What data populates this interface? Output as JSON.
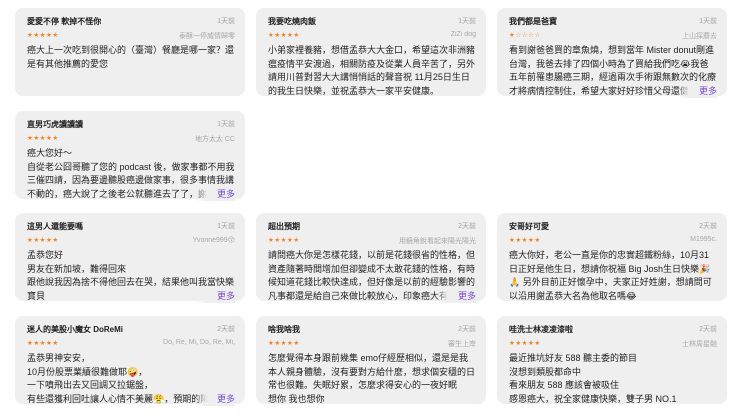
{
  "accent_color": "#7b4ae2",
  "star_color": "#f5821f",
  "reviews": [
    {
      "title": "愛愛不停 軟掉不怪你",
      "date": "1天前",
      "author": "泰酥一停威情歸零",
      "rating": 5,
      "body": "癌大上一次吃到很開心的（臺灣）餐廳是哪一家？還是有其他推薦的愛您",
      "more": ""
    },
    {
      "title": "我要吃燒肉飯",
      "date": "1天前",
      "author": "ZiZi dog",
      "rating": 5,
      "body": "小弟家裡養豬，想借孟恭大大金口，希望這次非洲豬瘟疫情平安渡過，相關防疫及從業人員辛苦了，另外請用川普對習大大講悄悄話的聲音祝 11月25日生日的我生日快樂，並祝孟恭大一家平安健康。",
      "more": ""
    },
    {
      "title": "我們都是爸寶",
      "date": "1天前",
      "author": "上山採蘑去",
      "rating": 1,
      "body": "看到謝爸爸買的章魚燒，想到當年 Mister donut剛進台灣，我爸去排了四個小時為了買給我們吃😭我爸五年前罹患腸癌三期，經過兩次手術跟無數次的化療才將病情控制住，希望大家好好珍惜父母還健康的時候",
      "more": "更多"
    },
    {
      "title": "直男巧虎讀讀讀",
      "date": "1天前",
      "author": "地方太太 CC",
      "rating": 5,
      "body": "癌大您好～\n自從老公囧哥聽了您的 podcast 後，做家事都不用我三催四請，因為要邊聽股癌邊做家事，很多事情我講不動的，癌大說了之後老公就聽進去了了，謝謝癌大",
      "more": "更多"
    },
    {
      "title": "這男人還能要嗎",
      "date": "1天前",
      "author": "Yvonne999😚",
      "rating": 5,
      "body": "孟恭您好\n男友在新加坡，難得回來\n跟他說我因為捨不得他回去在哭，結果他叫我當快樂寶貝",
      "more": "更多"
    },
    {
      "title": "超出預期",
      "date": "2天前",
      "author": "用鏡角銳看起來陽光陽光",
      "rating": 5,
      "body": "請問癌大你是怎樣花錢，以前是花錢很省的性格，但資產隨著時間增加但卻變成不太敢花錢的性格，有時候知道花錢比較快達成，但好像是以前的經驗影響的凡事都還是給自己來做比較放心，印象癌大有經驗過，",
      "more": "更多"
    },
    {
      "title": "安哥好可愛",
      "date": "2天前",
      "author": "M1995c.",
      "rating": 5,
      "body": "癌大你好，老公一直是你的忠實超鐵粉絲，10月31日正好是他生日，想請你祝福 Big Josh生日快樂🎉🙏 另外目前正好懷孕中，夫家正好姓謝，想請問可以沿用謝孟恭大名為他取名嗎😂",
      "more": ""
    },
    {
      "title": "迷人的美股小魔女 DoReMi",
      "date": "2天前",
      "author": "Do, Re, Mi, Do, Re, Mi,",
      "rating": 5,
      "body": "孟恭男神安安，\n10月份股票業績很難做耶🤪，\n一下噴飛出去又回調又拉鋸盤，\n有些還獲利回吐讓人心情不美麗😤，預期的降息",
      "more": "更多"
    },
    {
      "title": "啥我啥我",
      "date": "2天前",
      "author": "審生上岸",
      "rating": 5,
      "body": "怎麼覺得本身跟前幾集 emo仔經歷相似，還是是我本人親身體驗，沒有要對方給什麼，想求個安穩的日常也很難。失眠好累，怎麼求得安心的一夜好眠\n想你 我也想你",
      "more": ""
    },
    {
      "title": "哇洗士林凌凌漆啦",
      "date": "2天前",
      "author": "士林周星馳",
      "rating": 5,
      "body": "最近推坑好友 588 聽主委的節目\n沒想到類股都命中\n看來朋友 588 應該會被吸住\n感恩癌大，祝全家健康快樂，雙子男 NO.1",
      "more": ""
    }
  ]
}
